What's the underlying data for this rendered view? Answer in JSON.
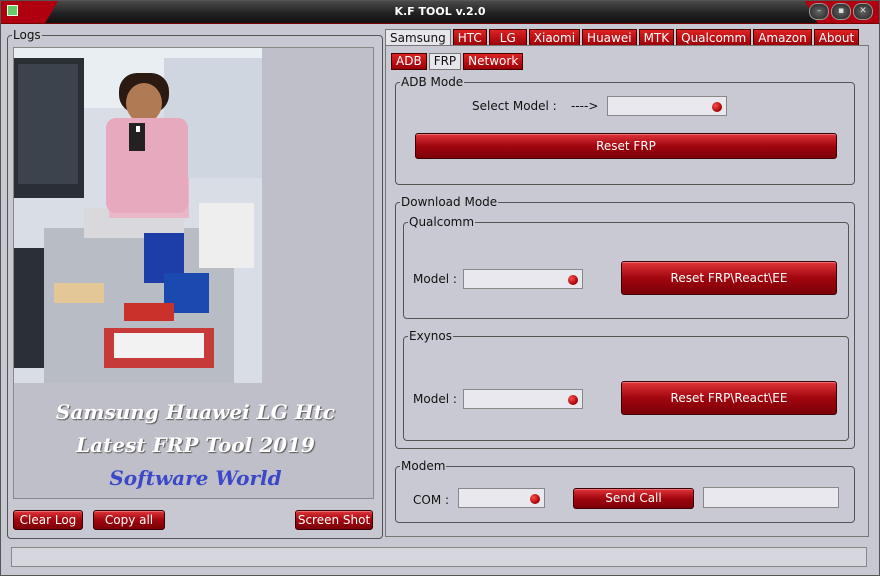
{
  "window": {
    "title": "K.F TOOL v.2.0"
  },
  "logs": {
    "legend": "Logs",
    "promo_line1": "Samsung Huawei LG Htc",
    "promo_line2": "Latest FRP Tool 2019",
    "promo_line3": "Software World",
    "buttons": {
      "clear": "Clear Log",
      "copy": "Copy all",
      "screenshot": "Screen Shot"
    }
  },
  "tabs": [
    "Samsung",
    "HTC",
    "LG",
    "Xiaomi",
    "Huawei",
    "MTK",
    "Qualcomm",
    "Amazon",
    "About"
  ],
  "selected_tab": "Samsung",
  "subtabs": [
    "ADB",
    "FRP",
    "Network"
  ],
  "selected_subtab": "FRP",
  "adb_mode": {
    "legend": "ADB Mode",
    "select_label": "Select Model :",
    "arrow": "---->",
    "reset_button": "Reset FRP"
  },
  "download_mode": {
    "legend": "Download Mode",
    "qualcomm": {
      "legend": "Qualcomm",
      "model_label": "Model :",
      "button": "Reset FRP\\React\\EE"
    },
    "exynos": {
      "legend": "Exynos",
      "model_label": "Model :",
      "button": "Reset FRP\\React\\EE"
    }
  },
  "modem": {
    "legend": "Modem",
    "com_label": "COM :",
    "button": "Send Call"
  },
  "colors": {
    "accent": "#a1060e",
    "window_bg": "#c8c8d2"
  }
}
